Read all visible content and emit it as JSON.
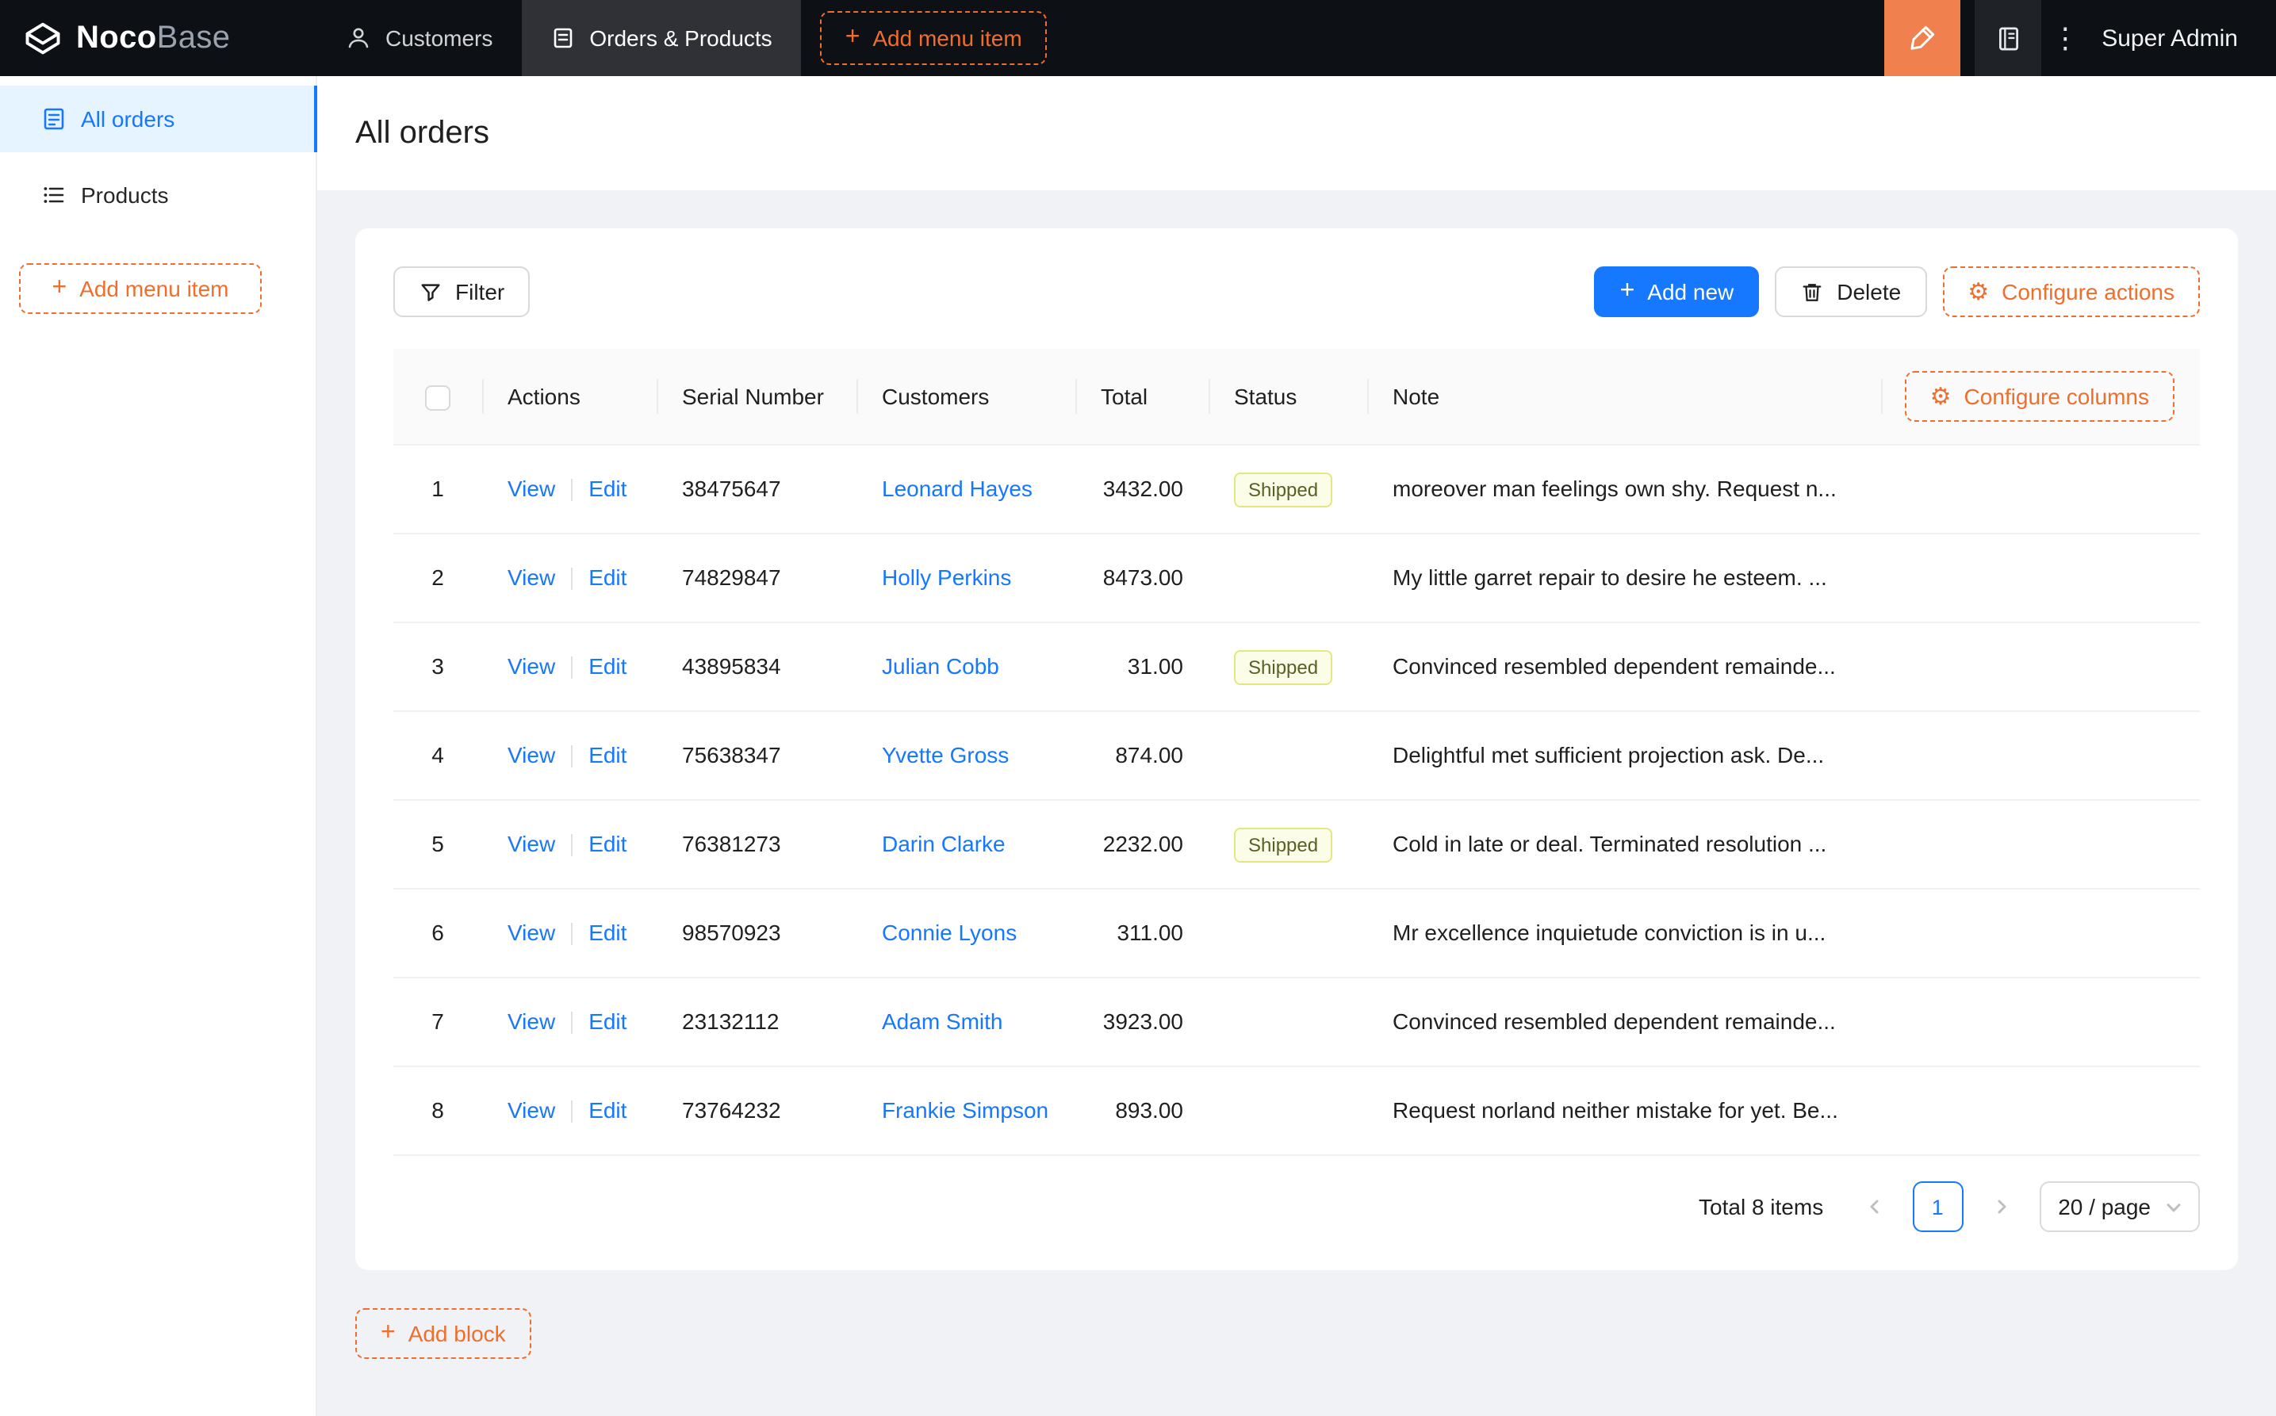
{
  "colors": {
    "accent-blue": "#1677ff",
    "accent-orange": "#ee6f2d",
    "accent-orange-strong": "#f0814e",
    "navbar-bg": "#0d1015",
    "page-bg": "#f0f2f5",
    "tag-bg": "#fcfde8",
    "tag-border": "#e2e77f",
    "tag-text": "#5a5f26"
  },
  "icons": {
    "plus": "+",
    "settings": "⚙",
    "ellipsis": "⋮"
  },
  "navbar": {
    "logo_primary": "Noco",
    "logo_secondary": "Base",
    "tabs": [
      {
        "label": "Customers"
      },
      {
        "label": "Orders & Products"
      }
    ],
    "add_menu_item": "Add menu item",
    "user": "Super Admin"
  },
  "sidebar": {
    "items": [
      {
        "label": "All orders"
      },
      {
        "label": "Products"
      }
    ],
    "add_menu_item": "Add menu item"
  },
  "page": {
    "title": "All orders",
    "add_block": "Add block"
  },
  "toolbar": {
    "filter": "Filter",
    "add_new": "Add new",
    "delete": "Delete",
    "configure_actions": "Configure actions"
  },
  "table": {
    "configure_columns": "Configure columns",
    "columns": [
      "Actions",
      "Serial Number",
      "Customers",
      "Total",
      "Status",
      "Note"
    ],
    "actions": {
      "view": "View",
      "edit": "Edit"
    },
    "rows": [
      {
        "index": "1",
        "serial": "38475647",
        "customer": "Leonard Hayes",
        "total": "3432.00",
        "status": "Shipped",
        "note": "moreover man feelings own shy. Request n..."
      },
      {
        "index": "2",
        "serial": "74829847",
        "customer": "Holly Perkins",
        "total": "8473.00",
        "status": "",
        "note": "My little garret repair to desire he esteem. ..."
      },
      {
        "index": "3",
        "serial": "43895834",
        "customer": "Julian Cobb",
        "total": "31.00",
        "status": "Shipped",
        "note": "Convinced resembled dependent remainde..."
      },
      {
        "index": "4",
        "serial": "75638347",
        "customer": "Yvette Gross",
        "total": "874.00",
        "status": "",
        "note": "Delightful met sufficient projection ask. De..."
      },
      {
        "index": "5",
        "serial": "76381273",
        "customer": "Darin Clarke",
        "total": "2232.00",
        "status": "Shipped",
        "note": "Cold in late or deal. Terminated resolution ..."
      },
      {
        "index": "6",
        "serial": "98570923",
        "customer": "Connie Lyons",
        "total": "311.00",
        "status": "",
        "note": "Mr excellence inquietude conviction is in u..."
      },
      {
        "index": "7",
        "serial": "23132112",
        "customer": "Adam Smith",
        "total": "3923.00",
        "status": "",
        "note": "Convinced resembled dependent remainde..."
      },
      {
        "index": "8",
        "serial": "73764232",
        "customer": "Frankie Simpson",
        "total": "893.00",
        "status": "",
        "note": "Request norland neither mistake for yet. Be..."
      }
    ]
  },
  "pagination": {
    "total": "Total 8 items",
    "current": "1",
    "page_size": "20 / page"
  }
}
